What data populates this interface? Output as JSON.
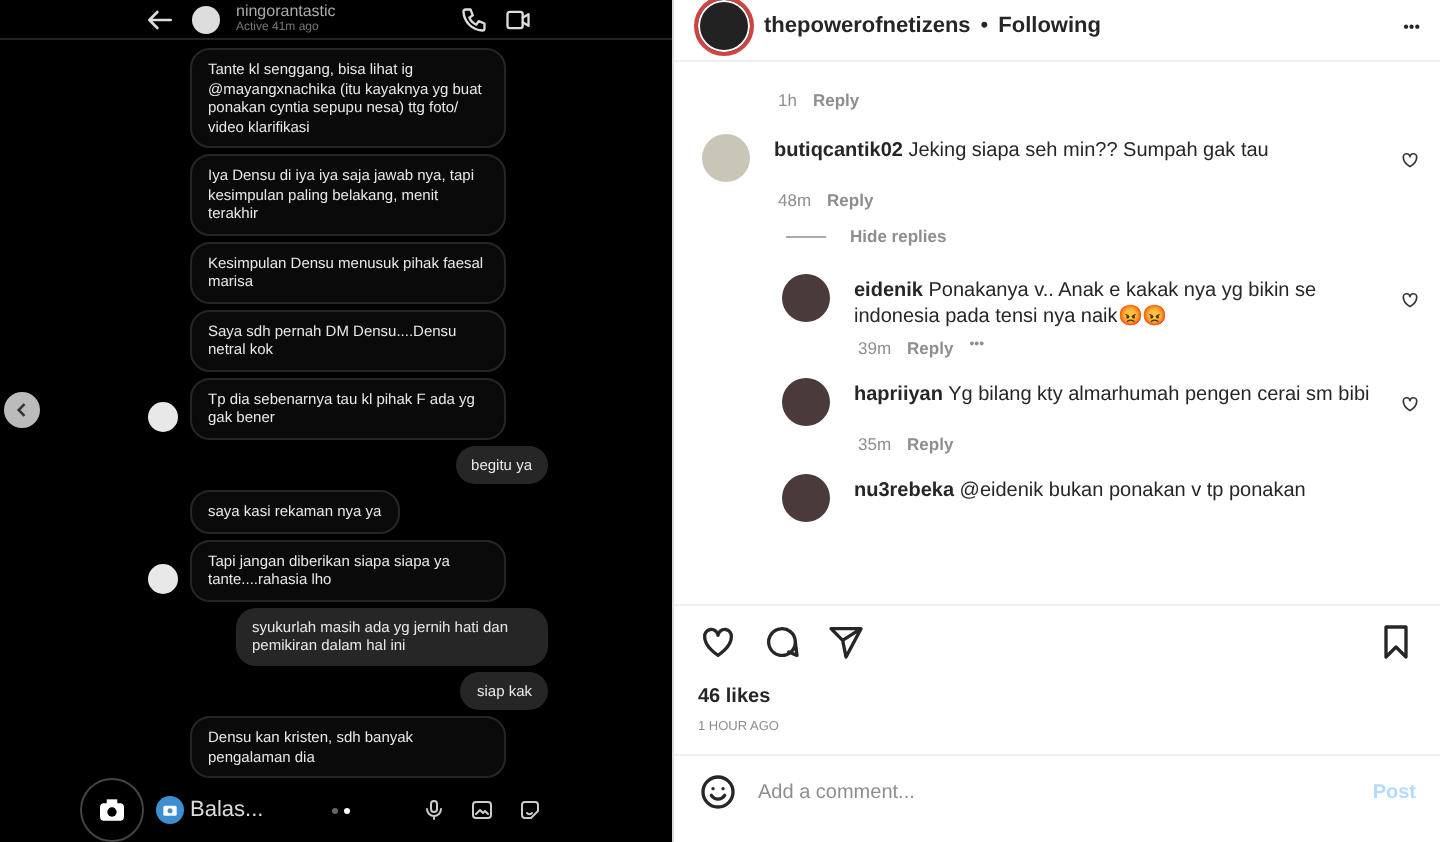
{
  "dm": {
    "username": "ningorantastic",
    "status": "Active 41m ago",
    "messages": [
      {
        "kind": "them",
        "text": "Tante kl senggang, bisa lihat ig @mayangxnachika (itu kayaknya yg buat ponakan cyntia sepupu nesa) ttg foto/ video klarifikasi",
        "avatar": false
      },
      {
        "kind": "them",
        "text": "Iya Densu di iya iya saja jawab nya, tapi kesimpulan paling belakang, menit terakhir",
        "avatar": false
      },
      {
        "kind": "them",
        "text": "Kesimpulan Densu menusuk pihak faesal marisa",
        "avatar": false
      },
      {
        "kind": "them",
        "text": "Saya sdh pernah DM Densu....Densu netral kok",
        "avatar": false
      },
      {
        "kind": "them",
        "text": "Tp dia sebenarnya tau kl pihak F ada yg gak bener",
        "avatar": true
      },
      {
        "kind": "me",
        "text": "begitu ya"
      },
      {
        "kind": "them",
        "text": "saya kasi rekaman nya ya",
        "avatar": false
      },
      {
        "kind": "them",
        "text": "Tapi jangan diberikan siapa siapa ya tante....rahasia lho",
        "avatar": true
      },
      {
        "kind": "me",
        "text": "syukurlah masih ada yg jernih hati dan pemikiran dalam hal ini"
      },
      {
        "kind": "me",
        "text": "siap kak"
      },
      {
        "kind": "them",
        "text": "Densu kan kristen, sdh banyak pengalaman dia",
        "avatar": false
      }
    ],
    "composer": {
      "placeholder": "Balas..."
    }
  },
  "post": {
    "account": "thepowerofnetizens",
    "separator": "•",
    "follow_status": "Following",
    "more": "•••",
    "top_meta": {
      "time": "1h",
      "reply": "Reply"
    },
    "comments": [
      {
        "user": "butiqcantik02",
        "text": "Jeking siapa seh min?? Sumpah gak tau",
        "time": "48m",
        "reply": "Reply",
        "toggle": "Hide replies",
        "children": [
          {
            "user": "eidenik",
            "text": "Ponakanya v.. Anak e kakak nya yg bikin se indonesia pada tensi nya naik😡😡",
            "time": "39m",
            "reply": "Reply",
            "more": "•••"
          },
          {
            "user": "hapriiyan",
            "text": "Yg bilang kty almarhumah pengen cerai sm bibi",
            "time": "35m",
            "reply": "Reply"
          },
          {
            "user": "nu3rebeka",
            "text": "@eidenik bukan ponakan v tp ponakan"
          }
        ]
      }
    ],
    "likes": "46 likes",
    "age": "1 HOUR AGO",
    "comment_placeholder": "Add a comment...",
    "post_button": "Post"
  }
}
